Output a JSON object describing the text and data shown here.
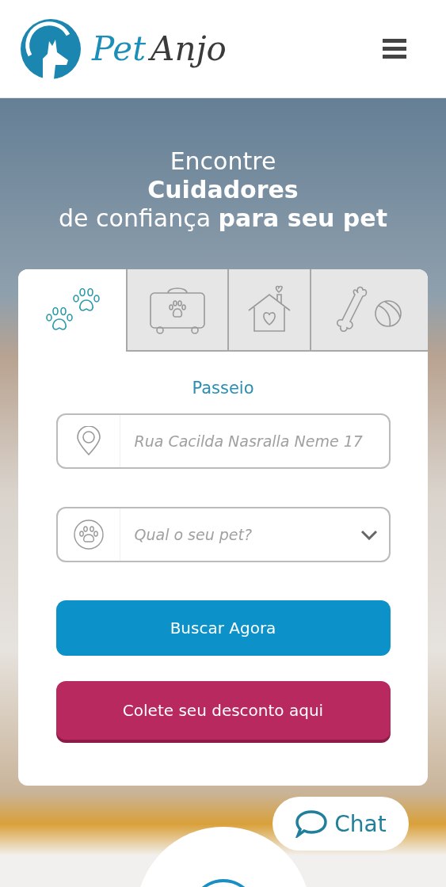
{
  "header": {
    "logo": {
      "word_1": "Pet",
      "word_2": "Anjo"
    }
  },
  "hero": {
    "lines": [
      "Encontre",
      "Cuidadores",
      "de confiança **para seu pet**"
    ]
  },
  "search_card": {
    "tabs": [
      {
        "kind": "walk",
        "selected": true
      },
      {
        "kind": "travel",
        "selected": false
      },
      {
        "kind": "home",
        "selected": false
      },
      {
        "kind": "play",
        "selected": false
      }
    ],
    "service_title": "Passeio",
    "address_field": {
      "placeholder": "Rua Cacilda Nasralla Neme 17"
    },
    "pet_select": {
      "placeholder": "Qual o seu pet?"
    },
    "buttons": [
      {
        "kind": "primary",
        "label": "Buscar Agora"
      },
      {
        "kind": "promo",
        "label": "Colete seu desconto aqui"
      }
    ]
  },
  "chat_button": {
    "label": "Chat"
  }
}
